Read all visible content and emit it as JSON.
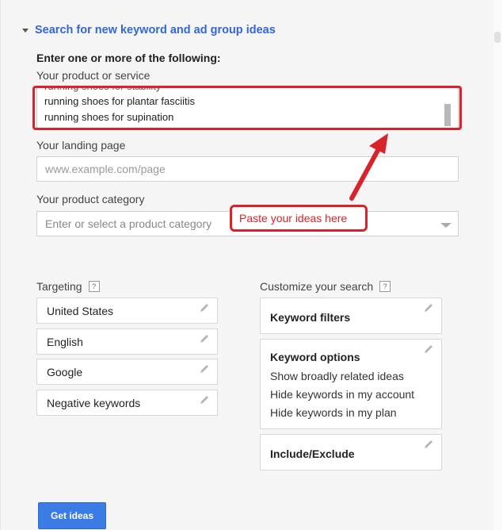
{
  "colors": {
    "link": "#3367d6",
    "highlight": "#d9232b",
    "button": "#3b7be6"
  },
  "section": {
    "title": "Search for new keyword and ad group ideas",
    "expanded_icon": "caret-down-icon"
  },
  "form": {
    "instruction": "Enter one or more of the following:",
    "product_label": "Your product or service",
    "product_lines": [
      "running shoes for plantar fasciitis",
      "running shoes for supination"
    ],
    "landing_label": "Your landing page",
    "landing_placeholder": "www.example.com/page",
    "category_label": "Your product category",
    "category_placeholder": "Enter or select a product category"
  },
  "annotation": {
    "callout_text": "Paste your ideas here"
  },
  "targeting": {
    "heading": "Targeting",
    "help": "?",
    "items": [
      "United States",
      "English",
      "Google",
      "Negative keywords"
    ]
  },
  "customize": {
    "heading": "Customize your search",
    "help": "?",
    "keyword_filters": "Keyword filters",
    "keyword_options": {
      "title": "Keyword options",
      "lines": [
        "Show broadly related ideas",
        "Hide keywords in my account",
        "Hide keywords in my plan"
      ]
    },
    "include_exclude": "Include/Exclude"
  },
  "actions": {
    "get_ideas": "Get ideas"
  }
}
